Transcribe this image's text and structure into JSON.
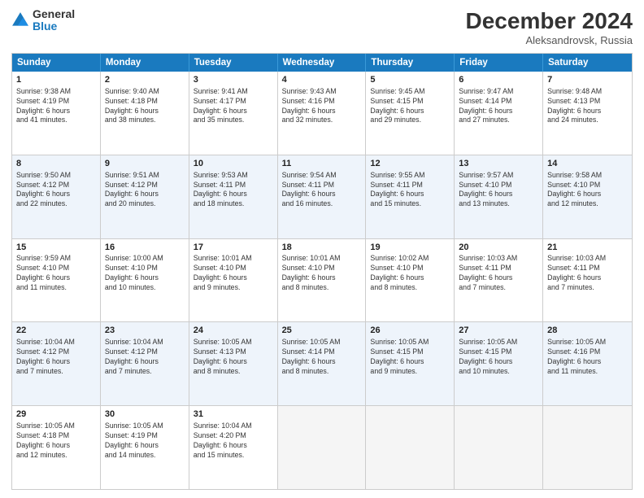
{
  "header": {
    "logo_general": "General",
    "logo_blue": "Blue",
    "month_title": "December 2024",
    "location": "Aleksandrovsk, Russia"
  },
  "days_of_week": [
    "Sunday",
    "Monday",
    "Tuesday",
    "Wednesday",
    "Thursday",
    "Friday",
    "Saturday"
  ],
  "rows": [
    [
      {
        "day": "1",
        "lines": [
          "Sunrise: 9:38 AM",
          "Sunset: 4:19 PM",
          "Daylight: 6 hours",
          "and 41 minutes."
        ]
      },
      {
        "day": "2",
        "lines": [
          "Sunrise: 9:40 AM",
          "Sunset: 4:18 PM",
          "Daylight: 6 hours",
          "and 38 minutes."
        ]
      },
      {
        "day": "3",
        "lines": [
          "Sunrise: 9:41 AM",
          "Sunset: 4:17 PM",
          "Daylight: 6 hours",
          "and 35 minutes."
        ]
      },
      {
        "day": "4",
        "lines": [
          "Sunrise: 9:43 AM",
          "Sunset: 4:16 PM",
          "Daylight: 6 hours",
          "and 32 minutes."
        ]
      },
      {
        "day": "5",
        "lines": [
          "Sunrise: 9:45 AM",
          "Sunset: 4:15 PM",
          "Daylight: 6 hours",
          "and 29 minutes."
        ]
      },
      {
        "day": "6",
        "lines": [
          "Sunrise: 9:47 AM",
          "Sunset: 4:14 PM",
          "Daylight: 6 hours",
          "and 27 minutes."
        ]
      },
      {
        "day": "7",
        "lines": [
          "Sunrise: 9:48 AM",
          "Sunset: 4:13 PM",
          "Daylight: 6 hours",
          "and 24 minutes."
        ]
      }
    ],
    [
      {
        "day": "8",
        "lines": [
          "Sunrise: 9:50 AM",
          "Sunset: 4:12 PM",
          "Daylight: 6 hours",
          "and 22 minutes."
        ]
      },
      {
        "day": "9",
        "lines": [
          "Sunrise: 9:51 AM",
          "Sunset: 4:12 PM",
          "Daylight: 6 hours",
          "and 20 minutes."
        ]
      },
      {
        "day": "10",
        "lines": [
          "Sunrise: 9:53 AM",
          "Sunset: 4:11 PM",
          "Daylight: 6 hours",
          "and 18 minutes."
        ]
      },
      {
        "day": "11",
        "lines": [
          "Sunrise: 9:54 AM",
          "Sunset: 4:11 PM",
          "Daylight: 6 hours",
          "and 16 minutes."
        ]
      },
      {
        "day": "12",
        "lines": [
          "Sunrise: 9:55 AM",
          "Sunset: 4:11 PM",
          "Daylight: 6 hours",
          "and 15 minutes."
        ]
      },
      {
        "day": "13",
        "lines": [
          "Sunrise: 9:57 AM",
          "Sunset: 4:10 PM",
          "Daylight: 6 hours",
          "and 13 minutes."
        ]
      },
      {
        "day": "14",
        "lines": [
          "Sunrise: 9:58 AM",
          "Sunset: 4:10 PM",
          "Daylight: 6 hours",
          "and 12 minutes."
        ]
      }
    ],
    [
      {
        "day": "15",
        "lines": [
          "Sunrise: 9:59 AM",
          "Sunset: 4:10 PM",
          "Daylight: 6 hours",
          "and 11 minutes."
        ]
      },
      {
        "day": "16",
        "lines": [
          "Sunrise: 10:00 AM",
          "Sunset: 4:10 PM",
          "Daylight: 6 hours",
          "and 10 minutes."
        ]
      },
      {
        "day": "17",
        "lines": [
          "Sunrise: 10:01 AM",
          "Sunset: 4:10 PM",
          "Daylight: 6 hours",
          "and 9 minutes."
        ]
      },
      {
        "day": "18",
        "lines": [
          "Sunrise: 10:01 AM",
          "Sunset: 4:10 PM",
          "Daylight: 6 hours",
          "and 8 minutes."
        ]
      },
      {
        "day": "19",
        "lines": [
          "Sunrise: 10:02 AM",
          "Sunset: 4:10 PM",
          "Daylight: 6 hours",
          "and 8 minutes."
        ]
      },
      {
        "day": "20",
        "lines": [
          "Sunrise: 10:03 AM",
          "Sunset: 4:11 PM",
          "Daylight: 6 hours",
          "and 7 minutes."
        ]
      },
      {
        "day": "21",
        "lines": [
          "Sunrise: 10:03 AM",
          "Sunset: 4:11 PM",
          "Daylight: 6 hours",
          "and 7 minutes."
        ]
      }
    ],
    [
      {
        "day": "22",
        "lines": [
          "Sunrise: 10:04 AM",
          "Sunset: 4:12 PM",
          "Daylight: 6 hours",
          "and 7 minutes."
        ]
      },
      {
        "day": "23",
        "lines": [
          "Sunrise: 10:04 AM",
          "Sunset: 4:12 PM",
          "Daylight: 6 hours",
          "and 7 minutes."
        ]
      },
      {
        "day": "24",
        "lines": [
          "Sunrise: 10:05 AM",
          "Sunset: 4:13 PM",
          "Daylight: 6 hours",
          "and 8 minutes."
        ]
      },
      {
        "day": "25",
        "lines": [
          "Sunrise: 10:05 AM",
          "Sunset: 4:14 PM",
          "Daylight: 6 hours",
          "and 8 minutes."
        ]
      },
      {
        "day": "26",
        "lines": [
          "Sunrise: 10:05 AM",
          "Sunset: 4:15 PM",
          "Daylight: 6 hours",
          "and 9 minutes."
        ]
      },
      {
        "day": "27",
        "lines": [
          "Sunrise: 10:05 AM",
          "Sunset: 4:15 PM",
          "Daylight: 6 hours",
          "and 10 minutes."
        ]
      },
      {
        "day": "28",
        "lines": [
          "Sunrise: 10:05 AM",
          "Sunset: 4:16 PM",
          "Daylight: 6 hours",
          "and 11 minutes."
        ]
      }
    ],
    [
      {
        "day": "29",
        "lines": [
          "Sunrise: 10:05 AM",
          "Sunset: 4:18 PM",
          "Daylight: 6 hours",
          "and 12 minutes."
        ]
      },
      {
        "day": "30",
        "lines": [
          "Sunrise: 10:05 AM",
          "Sunset: 4:19 PM",
          "Daylight: 6 hours",
          "and 14 minutes."
        ]
      },
      {
        "day": "31",
        "lines": [
          "Sunrise: 10:04 AM",
          "Sunset: 4:20 PM",
          "Daylight: 6 hours",
          "and 15 minutes."
        ]
      },
      {
        "day": "",
        "lines": []
      },
      {
        "day": "",
        "lines": []
      },
      {
        "day": "",
        "lines": []
      },
      {
        "day": "",
        "lines": []
      }
    ]
  ]
}
